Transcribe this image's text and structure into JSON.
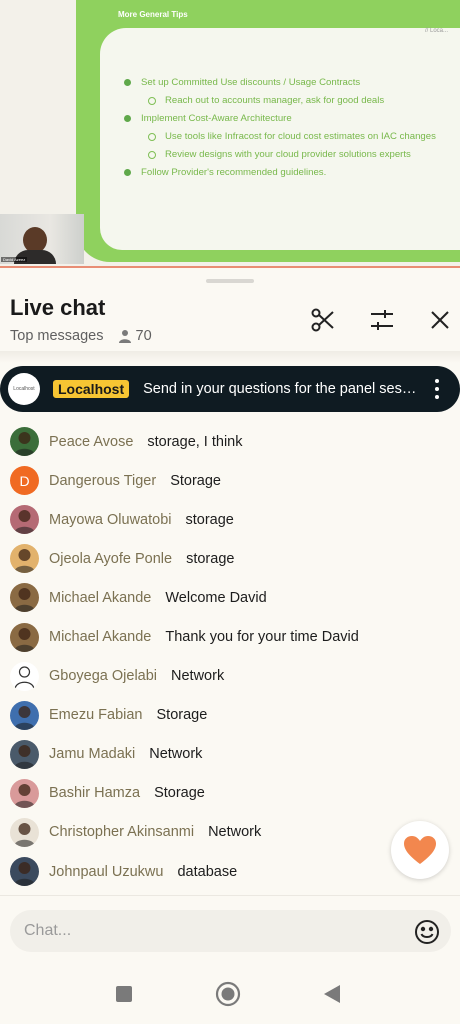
{
  "slide": {
    "header": "More General Tips",
    "corner": "// Loca...",
    "items": [
      {
        "level": 1,
        "text": "Set up Committed Use discounts / Usage Contracts"
      },
      {
        "level": 2,
        "text": "Reach out to accounts manager, ask for good deals"
      },
      {
        "level": 1,
        "text": "Implement Cost-Aware Architecture"
      },
      {
        "level": 2,
        "text": "Use tools like Infracost for cloud cost estimates on IAC changes"
      },
      {
        "level": 2,
        "text": "Review designs with your cloud provider solutions experts"
      },
      {
        "level": 1,
        "text": "Follow Provider's recommended guidelines."
      }
    ],
    "speaker_tag": "David Azeez"
  },
  "chat": {
    "title": "Live chat",
    "filter_label": "Top messages",
    "viewer_count": "70",
    "icons": {
      "viewers": "person-icon",
      "clip": "scissors-icon",
      "settings": "sliders-icon",
      "close": "close-icon"
    }
  },
  "pinned": {
    "logo_text": "Localhost",
    "channel": "Localhost",
    "message": "Send in your questions for the panel session here"
  },
  "messages": [
    {
      "author": "Peace Avose",
      "text": "storage, I think",
      "avatar": "photo",
      "color": "#3b6e3a"
    },
    {
      "author": "Dangerous Tiger",
      "text": "Storage",
      "avatar": "letter",
      "letter": "D",
      "color": "#f06a22"
    },
    {
      "author": "Mayowa Oluwatobi",
      "text": "storage",
      "avatar": "photo",
      "color": "#b56a74"
    },
    {
      "author": "Ojeola Ayofe Ponle",
      "text": "storage",
      "avatar": "photo",
      "color": "#e2b26c"
    },
    {
      "author": "Michael Akande",
      "text": "Welcome David",
      "avatar": "photo",
      "color": "#8a6a43"
    },
    {
      "author": "Michael Akande",
      "text": "Thank you for your time David",
      "avatar": "photo",
      "color": "#8a6a43"
    },
    {
      "author": "Gboyega Ojelabi",
      "text": "Network",
      "avatar": "sketch",
      "color": "#ffffff"
    },
    {
      "author": "Emezu Fabian",
      "text": "Storage",
      "avatar": "photo",
      "color": "#3f6fae"
    },
    {
      "author": "Jamu Madaki",
      "text": "Network",
      "avatar": "photo",
      "color": "#4a5a6a"
    },
    {
      "author": "Bashir Hamza",
      "text": "Storage",
      "avatar": "photo",
      "color": "#d99a9a"
    },
    {
      "author": "Christopher Akinsanmi",
      "text": "Network",
      "avatar": "photo",
      "color": "#e9e2d6"
    },
    {
      "author": "Johnpaul Uzukwu",
      "text": "database",
      "avatar": "photo",
      "color": "#3b4a5e"
    }
  ],
  "input": {
    "placeholder": "Chat..."
  },
  "colors": {
    "accent": "#f7c533",
    "heart": "#f2874e",
    "slide_green": "#8fd15e"
  },
  "nav": {
    "icons": [
      "square-icon",
      "home-circle-icon",
      "back-triangle-icon"
    ]
  }
}
